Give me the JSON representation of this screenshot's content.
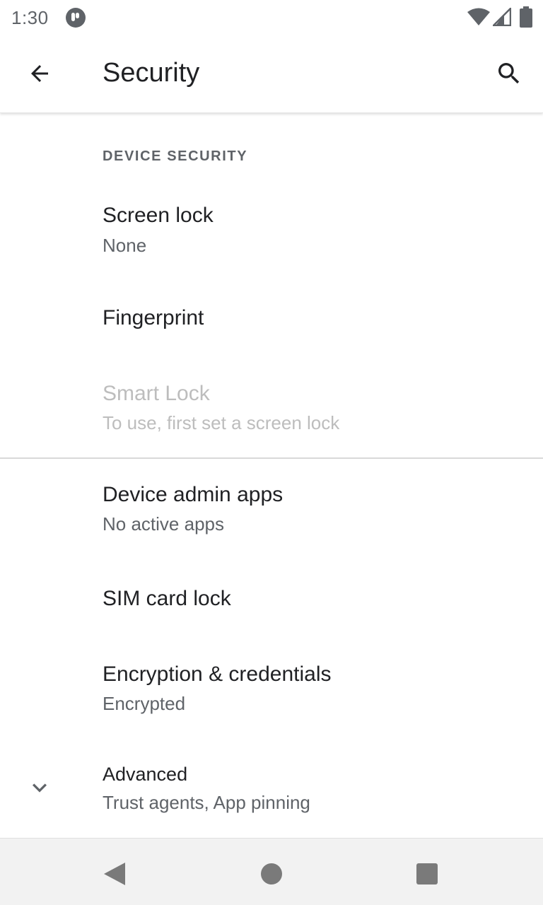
{
  "status_bar": {
    "time": "1:30",
    "icons": [
      "app-notification-icon",
      "wifi-icon",
      "cell-signal-icon",
      "battery-icon"
    ]
  },
  "app_bar": {
    "title": "Security",
    "back_icon": "arrow-back-icon",
    "search_icon": "search-icon"
  },
  "section": {
    "header": "DEVICE SECURITY"
  },
  "items": {
    "screen_lock": {
      "title": "Screen lock",
      "summary": "None"
    },
    "fingerprint": {
      "title": "Fingerprint"
    },
    "smart_lock": {
      "title": "Smart Lock",
      "summary": "To use, first set a screen lock",
      "enabled": false
    },
    "device_admin": {
      "title": "Device admin apps",
      "summary": "No active apps"
    },
    "sim_lock": {
      "title": "SIM card lock"
    },
    "encryption": {
      "title": "Encryption & credentials",
      "summary": "Encrypted"
    },
    "advanced": {
      "title": "Advanced",
      "summary": "Trust agents, App pinning",
      "icon": "chevron-down-icon"
    }
  },
  "nav_bar": {
    "icons": [
      "nav-back-icon",
      "nav-home-icon",
      "nav-recents-icon"
    ]
  },
  "colors": {
    "text_primary": "#202124",
    "text_secondary": "#5f6368",
    "text_disabled": "#bdbdbd",
    "divider": "#d9d9d9",
    "nav_bar_bg": "#f2f2f2"
  }
}
